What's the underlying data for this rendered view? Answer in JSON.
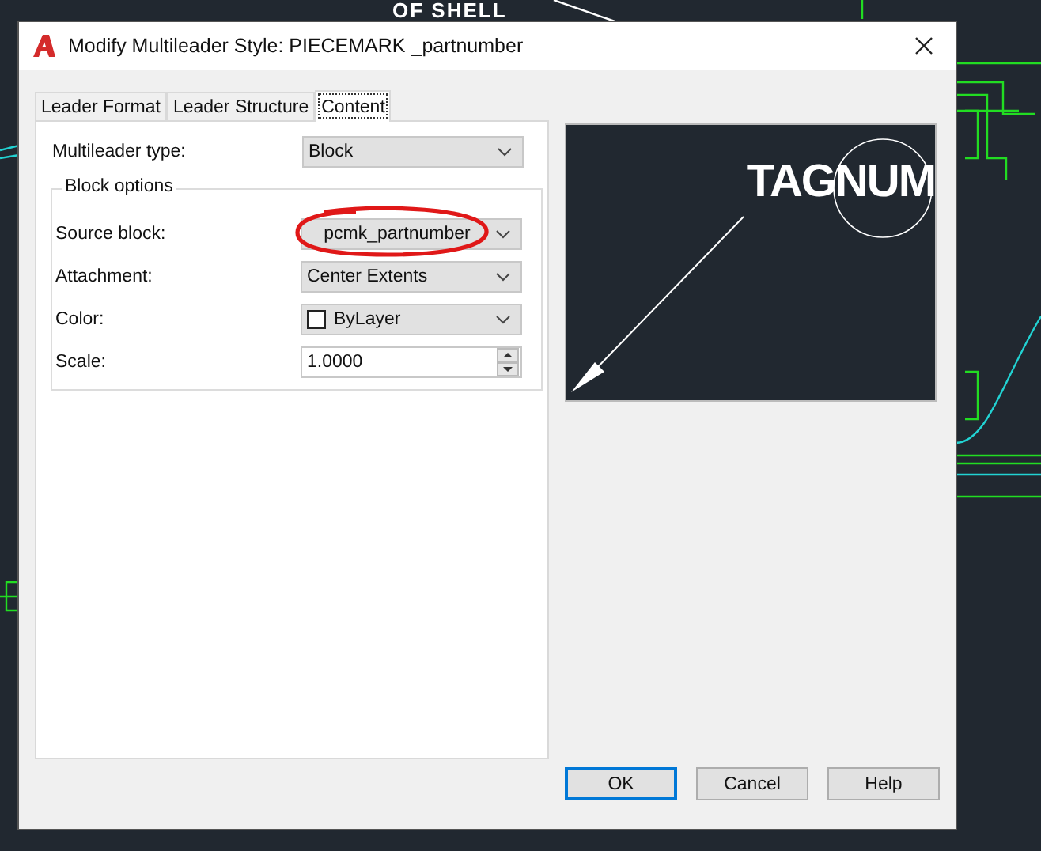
{
  "background": {
    "text": "OF SHELL"
  },
  "window": {
    "title": "Modify Multileader Style: PIECEMARK _partnumber"
  },
  "tabs": [
    {
      "label": "Leader Format",
      "selected": false
    },
    {
      "label": "Leader Structure",
      "selected": false
    },
    {
      "label": "Content",
      "selected": true
    }
  ],
  "content": {
    "multileader_type": {
      "label": "Multileader type:",
      "value": "Block"
    },
    "block_options": {
      "title": "Block options",
      "fields": [
        {
          "kind": "dropdown",
          "label": "Source block:",
          "value": "pcmk_partnumber",
          "highlighted": true
        },
        {
          "kind": "dropdown",
          "label": "Attachment:",
          "value": "Center Extents",
          "highlighted": false
        },
        {
          "kind": "color",
          "label": "Color:",
          "value": "ByLayer",
          "highlighted": false
        },
        {
          "kind": "spinner",
          "label": "Scale:",
          "value": "1.0000",
          "highlighted": false
        }
      ]
    }
  },
  "preview": {
    "text": "TAGNUM"
  },
  "buttons": [
    {
      "label": "OK",
      "default": true
    },
    {
      "label": "Cancel",
      "default": false
    },
    {
      "label": "Help",
      "default": false
    }
  ]
}
